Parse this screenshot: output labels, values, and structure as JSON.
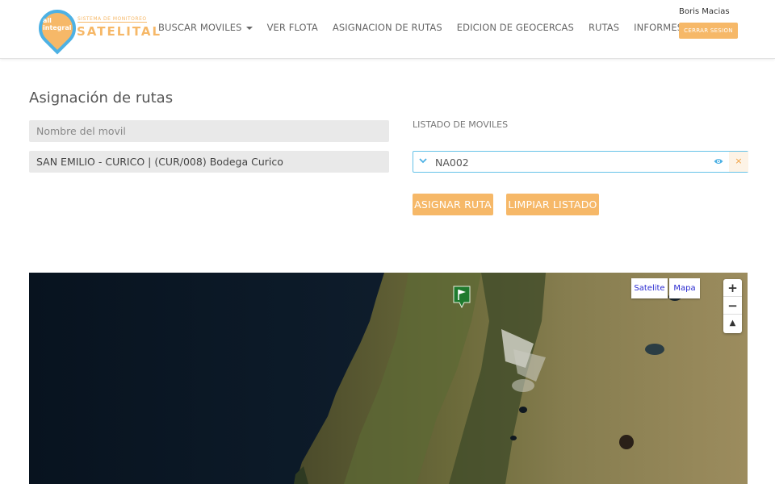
{
  "header": {
    "logo": {
      "pin_text": "all integral",
      "subtitle": "SISTEMA DE MONITOREO",
      "title": "SATELITAL"
    },
    "nav": [
      {
        "label": "BUSCAR MOVILES",
        "dropdown": true
      },
      {
        "label": "VER FLOTA",
        "dropdown": false
      },
      {
        "label": "ASIGNACION DE RUTAS",
        "dropdown": false
      },
      {
        "label": "EDICION DE GEOCERCAS",
        "dropdown": false
      },
      {
        "label": "RUTAS",
        "dropdown": false
      },
      {
        "label": "INFORMES",
        "dropdown": true
      }
    ],
    "user_name": "Boris Macias",
    "logout_label": "CERRAR SESION"
  },
  "main": {
    "title": "Asignación de rutas",
    "vehicle_name_placeholder": "Nombre del movil",
    "route_value": "SAN EMILIO - CURICO | (CUR/008) Bodega Curico",
    "list_label": "LISTADO DE MOVILES",
    "selected_vehicle": "NA002",
    "clear_selection": "×",
    "assign_button": "ASIGNAR RUTA",
    "clear_list_button": "LIMPIAR LISTADO"
  },
  "map": {
    "type_satellite": "Satelite",
    "type_map": "Mapa",
    "zoom_in": "+",
    "zoom_out": "−",
    "reset_north": "▲"
  },
  "colors": {
    "accent": "#f6b868",
    "select_border": "#66c2e8",
    "logo_blue": "#4db1e4",
    "marker_green": "#1f7a2e"
  }
}
